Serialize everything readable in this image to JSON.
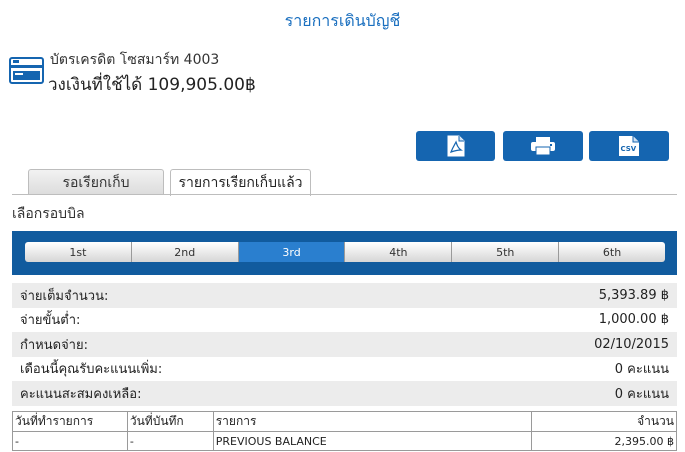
{
  "page": {
    "title": "รายการเดินบัญชี"
  },
  "card": {
    "name": "บัตรเครดิต โซสมาร์ท 4003",
    "limit_text": "วงเงินที่ใช้ได้ 109,905.00฿",
    "icon": "credit-card-icon"
  },
  "toolbar": {
    "icons": [
      "pdf-icon",
      "printer-icon",
      "csv-icon"
    ],
    "csv_label": "CSV"
  },
  "tabs": [
    {
      "label": "รอเรียกเก็บ",
      "active": false
    },
    {
      "label": "รายการเรียกเก็บแล้ว",
      "active": true
    }
  ],
  "cycle": {
    "label": "เลือกรอบบิล",
    "options": [
      "1st",
      "2nd",
      "3rd",
      "4th",
      "5th",
      "6th"
    ],
    "selected": "3rd"
  },
  "summary": [
    {
      "label": "จ่ายเต็มจำนวน:",
      "value": "5,393.89 ฿"
    },
    {
      "label": "จ่ายขั้นต่ำ:",
      "value": "1,000.00 ฿"
    },
    {
      "label": "กำหนดจ่าย:",
      "value": "02/10/2015"
    },
    {
      "label": "เดือนนี้คุณรับคะแนนเพิ่ม:",
      "value": "0 คะแนน"
    },
    {
      "label": "คะแนนสะสมคงเหลือ:",
      "value": "0 คะแนน"
    }
  ],
  "transactions": {
    "headers": [
      "วันที่ทำรายการ",
      "วันที่บันทึก",
      "รายการ",
      "จำนวน"
    ],
    "rows": [
      [
        "-",
        "-",
        "PREVIOUS BALANCE",
        "2,395.00 ฿"
      ]
    ]
  },
  "colors": {
    "primary": "#1565b0",
    "cycle_bar": "#115b9e",
    "active_cycle": "#2a7fcf",
    "title": "#1a6fbf"
  }
}
